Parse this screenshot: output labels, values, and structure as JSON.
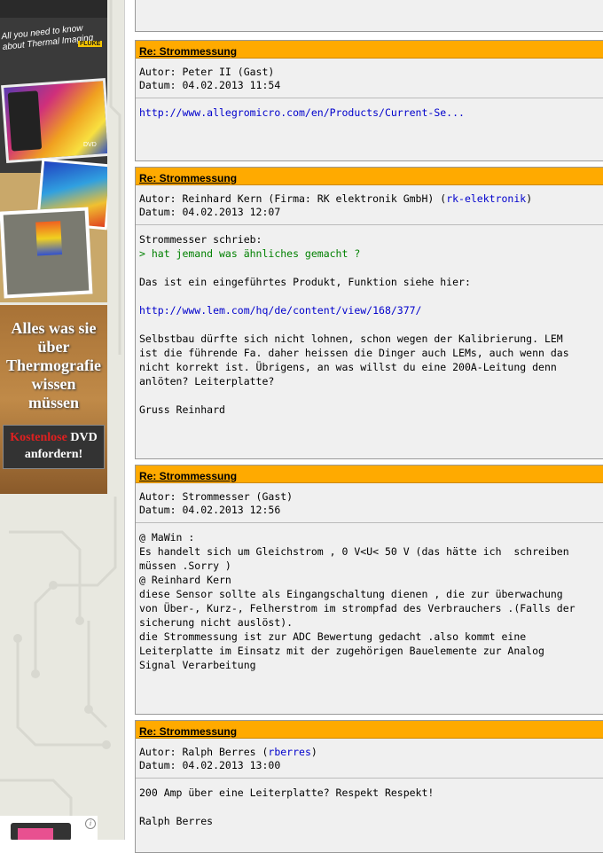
{
  "ads": {
    "fluke_brand": "FLUKE",
    "book_text": "All you need to know about Thermal Imaging",
    "dvd_label": "DVD",
    "banner_headline": [
      "Alles was sie",
      "über",
      "Thermografie",
      "wissen",
      "müssen"
    ],
    "banner_cta_red": "Kostenlose",
    "banner_cta_dvd": " DVD",
    "banner_cta_line2": "anfordern!",
    "info_glyph": "i"
  },
  "posts": [
    {
      "title": "Re: Strommessung",
      "author": "Autor: Peter II (Gast)",
      "date": "Datum: 04.02.2013 11:54",
      "link": "http://www.allegromicro.com/en/Products/Current-Se..."
    },
    {
      "title": "Re: Strommessung",
      "author_prefix": "Autor: Reinhard Kern (Firma: RK elektronik GmbH) (",
      "author_link": "rk-elektronik",
      "author_suffix": ")",
      "date": "Datum: 04.02.2013 12:07",
      "quote_intro": "Strommesser schrieb:",
      "quote": "> hat jemand was ähnliches gemacht ?",
      "para1": "Das ist ein eingeführtes Produkt, Funktion siehe hier:",
      "link": "http://www.lem.com/hq/de/content/view/168/377/",
      "para2": "Selbstbau dürfte sich nicht lohnen, schon wegen der Kalibrierung. LEM\nist die führende Fa. daher heissen die Dinger auch LEMs, auch wenn das\nnicht korrekt ist. Übrigens, an was willst du eine 200A-Leitung denn\nanlöten? Leiterplatte?",
      "signature": "Gruss Reinhard"
    },
    {
      "title": "Re: Strommessung",
      "author": "Autor: Strommesser (Gast)",
      "date": "Datum: 04.02.2013 12:56",
      "text": "@ MaWin :\nEs handelt sich um Gleichstrom , 0 V<U< 50 V (das hätte ich  schreiben\nmüssen .Sorry )\n@ Reinhard Kern\ndiese Sensor sollte als Eingangschaltung dienen , die zur überwachung\nvon Über-, Kurz-, Felherstrom im strompfad des Verbrauchers .(Falls der\nsicherung nicht auslöst).\ndie Strommessung ist zur ADC Bewertung gedacht .also kommt eine\nLeiterplatte im Einsatz mit der zugehörigen Bauelemente zur Analog\nSignal Verarbeitung"
    },
    {
      "title": "Re: Strommessung",
      "author_prefix": "Autor: Ralph Berres (",
      "author_link": "rberres",
      "author_suffix": ")",
      "date": "Datum: 04.02.2013 13:00",
      "text": "200 Amp über eine Leiterplatte? Respekt Respekt!",
      "signature": "Ralph Berres"
    }
  ]
}
